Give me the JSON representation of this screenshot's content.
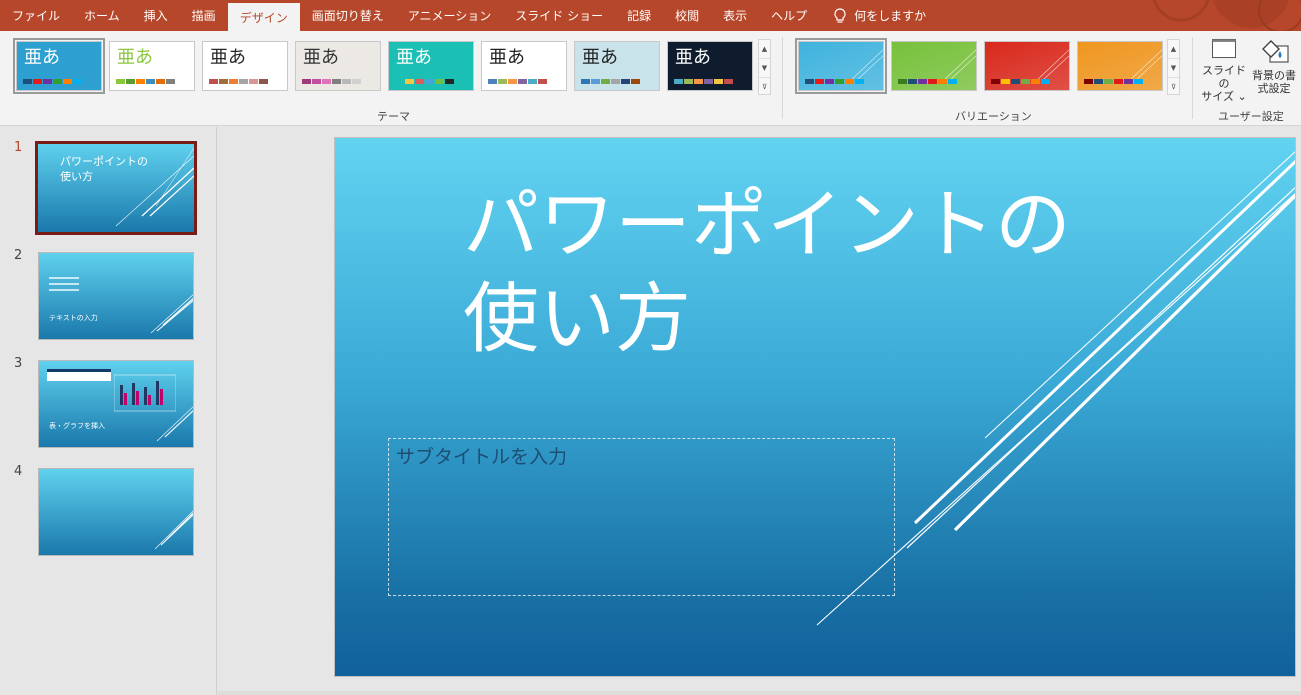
{
  "tabs": [
    {
      "label": "ファイル",
      "active": false
    },
    {
      "label": "ホーム",
      "active": false
    },
    {
      "label": "挿入",
      "active": false
    },
    {
      "label": "描画",
      "active": false
    },
    {
      "label": "デザイン",
      "active": true
    },
    {
      "label": "画面切り替え",
      "active": false
    },
    {
      "label": "アニメーション",
      "active": false
    },
    {
      "label": "スライド ショー",
      "active": false
    },
    {
      "label": "記録",
      "active": false
    },
    {
      "label": "校閲",
      "active": false
    },
    {
      "label": "表示",
      "active": false
    },
    {
      "label": "ヘルプ",
      "active": false
    }
  ],
  "tell_me": {
    "label": "何をしますか",
    "icon": "lightbulb-icon"
  },
  "themes": {
    "group_label": "テーマ",
    "glyph": "亜あ",
    "items": [
      {
        "bg": "#2d9fd0",
        "glyph_color": "#ffffff",
        "swatches": [
          "#1f4e79",
          "#e31a1c",
          "#7030a0",
          "#33a02c",
          "#ff7f00",
          "#00b0f0"
        ]
      },
      {
        "bg": "#ffffff",
        "glyph_color": "#8cc63f",
        "swatches": [
          "#8cc63f",
          "#5b9b32",
          "#ff7f00",
          "#3c8dbc",
          "#e36c09",
          "#7f7f7f"
        ]
      },
      {
        "bg": "#ffffff",
        "glyph_color": "#262626",
        "swatches": [
          "#c0504d",
          "#9f6e3c",
          "#ed7d31",
          "#a5a5a5",
          "#d99694",
          "#8c564b"
        ]
      },
      {
        "bg": "#ece9e4",
        "glyph_color": "#333333",
        "swatches": [
          "#a03a79",
          "#c14f9e",
          "#e072b8",
          "#7f7f7f",
          "#b9b9b9",
          "#d1d1d1"
        ]
      },
      {
        "bg": "#1bbfb3",
        "glyph_color": "#ffffff",
        "swatches": [
          "#1bbfb3",
          "#f3c744",
          "#e05b5b",
          "#4aa3df",
          "#72bf44",
          "#262626"
        ]
      },
      {
        "bg": "#ffffff",
        "glyph_color": "#222222",
        "swatches": [
          "#4f81bd",
          "#9bbb59",
          "#f79646",
          "#8064a2",
          "#4bacc6",
          "#c0504d"
        ]
      },
      {
        "bg": "#c9e3ea",
        "glyph_color": "#222222",
        "swatches": [
          "#2e75b6",
          "#5b9bd5",
          "#70ad47",
          "#a5a5a5",
          "#264478",
          "#9e480e"
        ]
      },
      {
        "bg": "#0e1c2e",
        "glyph_color": "#ffffff",
        "swatches": [
          "#4bacc6",
          "#9bbb59",
          "#f79646",
          "#8064a2",
          "#f3c744",
          "#c0504d"
        ]
      }
    ]
  },
  "variations": {
    "group_label": "バリエーション",
    "items": [
      {
        "bg": "#3fb3de",
        "swatches": [
          "#1f4e79",
          "#e31a1c",
          "#7030a0",
          "#33a02c",
          "#ff7f00",
          "#00b0f0"
        ]
      },
      {
        "bg": "#77c13a",
        "swatches": [
          "#3a7d1c",
          "#1f4e79",
          "#7030a0",
          "#e31a1c",
          "#ff7f00",
          "#00b0f0"
        ]
      },
      {
        "bg": "#d9281b",
        "swatches": [
          "#7f0000",
          "#ffc000",
          "#1f4e79",
          "#70ad47",
          "#ff7f00",
          "#00b0f0"
        ]
      },
      {
        "bg": "#f0961f",
        "swatches": [
          "#7f0000",
          "#1f4e79",
          "#70ad47",
          "#e31a1c",
          "#7030a0",
          "#00b0f0"
        ]
      }
    ]
  },
  "customize": {
    "group_label": "ユーザー設定",
    "slide_size": {
      "line1": "スライドの",
      "line2": "サイズ ⌄",
      "icon": "slide-size-icon"
    },
    "format_background": {
      "line1": "背景の書",
      "line2": "式設定",
      "icon": "format-background-icon"
    }
  },
  "slides": [
    {
      "number": "1",
      "title": "パワーポイントの使い方",
      "title_line1": "パワーポイントの",
      "title_line2": "使い方",
      "active": true
    },
    {
      "number": "2",
      "title": "テキストの入力",
      "active": false
    },
    {
      "number": "3",
      "title": "表・グラフを挿入",
      "active": false
    },
    {
      "number": "4",
      "title": "",
      "active": false
    }
  ],
  "main_slide": {
    "title_line1": "パワーポイントの",
    "title_line2": "使い方",
    "subtitle_placeholder": "サブタイトルを入力"
  },
  "colors": {
    "accent": "#b7472a",
    "ribbon_bg": "#f3f3f3",
    "active_thumb_border": "#7a1c16",
    "subtitle_text": "#1d4e73"
  }
}
